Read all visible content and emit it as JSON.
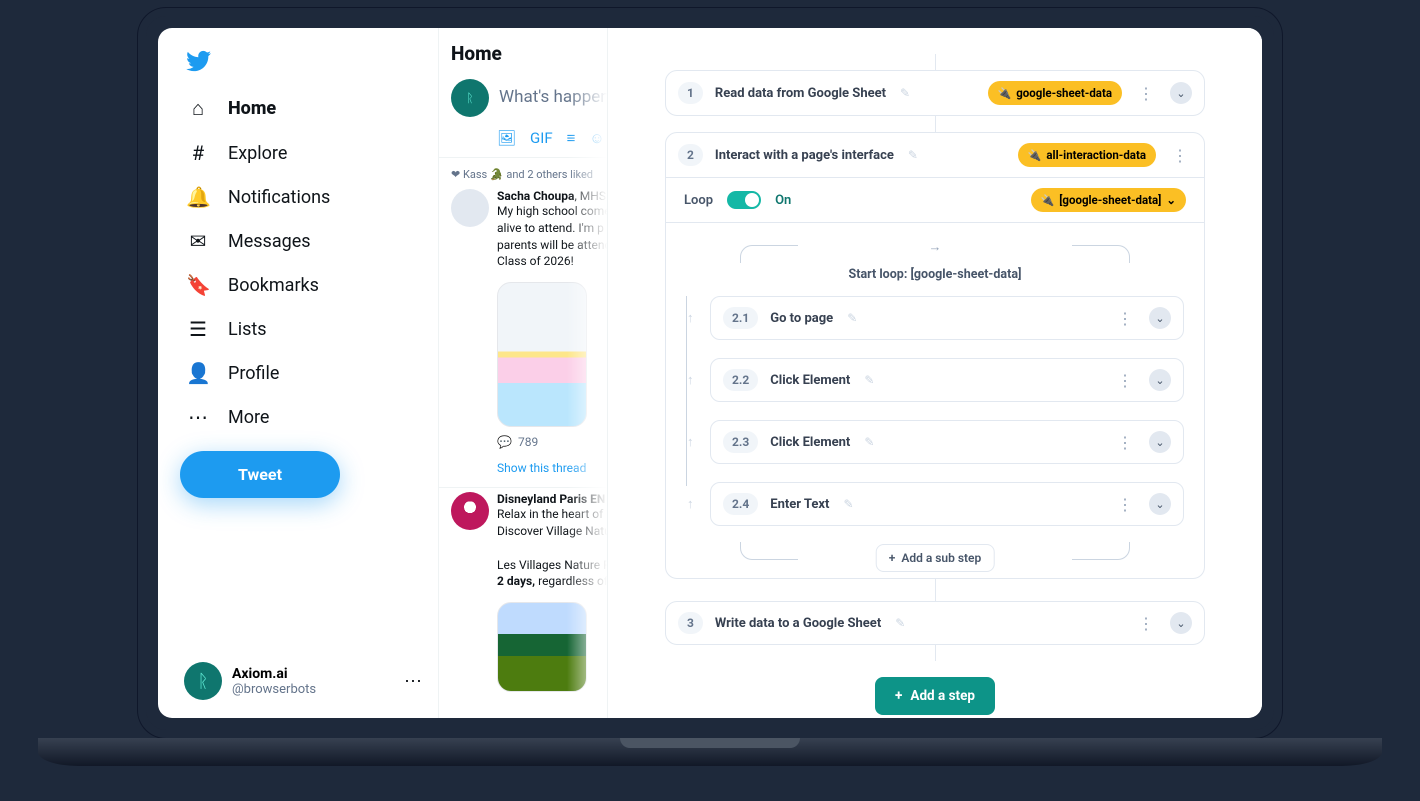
{
  "twitter": {
    "nav": {
      "home": "Home",
      "explore": "Explore",
      "notifications": "Notifications",
      "messages": "Messages",
      "bookmarks": "Bookmarks",
      "lists": "Lists",
      "profile": "Profile",
      "more": "More"
    },
    "tweet_button": "Tweet",
    "account": {
      "name": "Axiom.ai",
      "handle": "@browserbots"
    },
    "feed": {
      "header": "Home",
      "compose_placeholder": "What's happen",
      "liked_line": "Kass 🐊 and 2 others liked",
      "tweet1": {
        "name": "Sacha Choupa",
        "name_suffix": ", MHS",
        "line1": "My high school come",
        "line2": "alive to attend. I'm p",
        "line3": "parents will be attend",
        "line4": "Class of 2026!",
        "reply_count": "789",
        "show_thread": "Show this thread"
      },
      "tweet2": {
        "name": "Disneyland Paris EN",
        "line1": "Relax in the heart of",
        "line2": "Discover Village Natu",
        "line3": "Les Villages Nature P",
        "line4_a": "2 days, ",
        "line4_b": "regardless of"
      }
    }
  },
  "axiom": {
    "steps": {
      "s1": {
        "num": "1",
        "title": "Read data from Google Sheet",
        "chip": "google-sheet-data"
      },
      "s2": {
        "num": "2",
        "title": "Interact with a page's interface",
        "chip": "all-interaction-data",
        "loop_label": "Loop",
        "loop_state": "On",
        "loop_chip": "[google-sheet-data]",
        "loop_start": "Start loop: [google-sheet-data]",
        "subs": {
          "a": {
            "num": "2.1",
            "title": "Go to page"
          },
          "b": {
            "num": "2.2",
            "title": "Click Element"
          },
          "c": {
            "num": "2.3",
            "title": "Click Element"
          },
          "d": {
            "num": "2.4",
            "title": "Enter Text"
          }
        },
        "add_sub": "Add a sub step"
      },
      "s3": {
        "num": "3",
        "title": "Write data to a Google Sheet"
      }
    },
    "add_step": "Add a step"
  }
}
